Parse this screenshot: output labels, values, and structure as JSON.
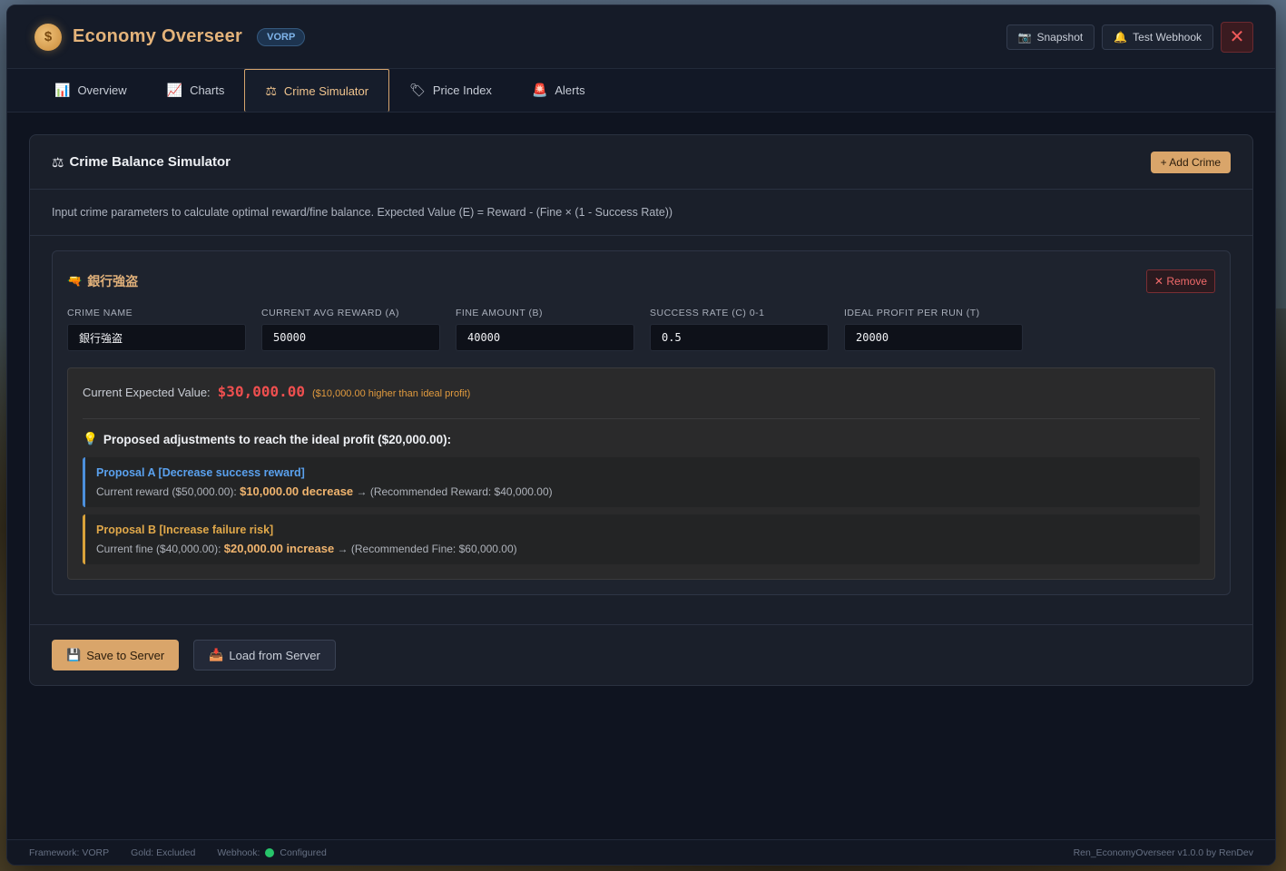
{
  "header": {
    "logo_glyph": "$",
    "app_title": "Economy Overseer",
    "framework_badge": "VORP",
    "snapshot_label": "Snapshot",
    "webhook_label": "Test Webhook",
    "close_glyph": "✕"
  },
  "tabs": [
    {
      "label": "Overview",
      "icon": "chart-bar-icon",
      "glyph": "📊"
    },
    {
      "label": "Charts",
      "icon": "chart-line-icon",
      "glyph": "📈"
    },
    {
      "label": "Crime Simulator",
      "icon": "scales-icon",
      "glyph": "⚖",
      "active": true
    },
    {
      "label": "Price Index",
      "icon": "tag-icon",
      "glyph": "🏷"
    },
    {
      "label": "Alerts",
      "icon": "siren-icon",
      "glyph": "🚨"
    }
  ],
  "simulator": {
    "title": "Crime Balance Simulator",
    "add_button": "+ Add Crime",
    "description": "Input crime parameters to calculate optimal reward/fine balance. Expected Value (E) = Reward - (Fine × (1 - Success Rate))",
    "crime": {
      "name": "銀行強盗",
      "remove_label": "Remove",
      "fields": [
        {
          "label": "CRIME NAME",
          "value": "銀行強盗"
        },
        {
          "label": "CURRENT AVG REWARD (A)",
          "value": "50000"
        },
        {
          "label": "FINE AMOUNT (B)",
          "value": "40000"
        },
        {
          "label": "SUCCESS RATE (C) 0-1",
          "value": "0.5"
        },
        {
          "label": "IDEAL PROFIT PER RUN (T)",
          "value": "20000"
        }
      ],
      "result": {
        "ev_label": "Current Expected Value:",
        "ev_value": "$30,000.00",
        "ev_note": "($10,000.00 higher than ideal profit)",
        "proposals_heading": "Proposed adjustments to reach the ideal profit ($20,000.00):",
        "proposal_a": {
          "title": "Proposal A [Decrease success reward]",
          "prefix": "Current reward ($50,000.00):",
          "strong": "$10,000.00 decrease",
          "suffix": "→ (Recommended Reward: $40,000.00)"
        },
        "proposal_b": {
          "title": "Proposal B [Increase failure risk]",
          "prefix": "Current fine ($40,000.00):",
          "strong": "$20,000.00 increase",
          "suffix": "→ (Recommended Fine: $60,000.00)"
        }
      }
    },
    "save_button": "Save to Server",
    "load_button": "Load from Server"
  },
  "status": {
    "framework": "Framework: VORP",
    "gold": "Gold: Excluded",
    "webhook_label": "Webhook:",
    "webhook_state": "Configured",
    "version": "Ren_EconomyOverseer v1.0.0 by RenDev"
  },
  "colors": {
    "accent": "#d9a56a",
    "danger": "#ef4f4f",
    "info": "#5aa1ee",
    "ok": "#27c46a"
  }
}
